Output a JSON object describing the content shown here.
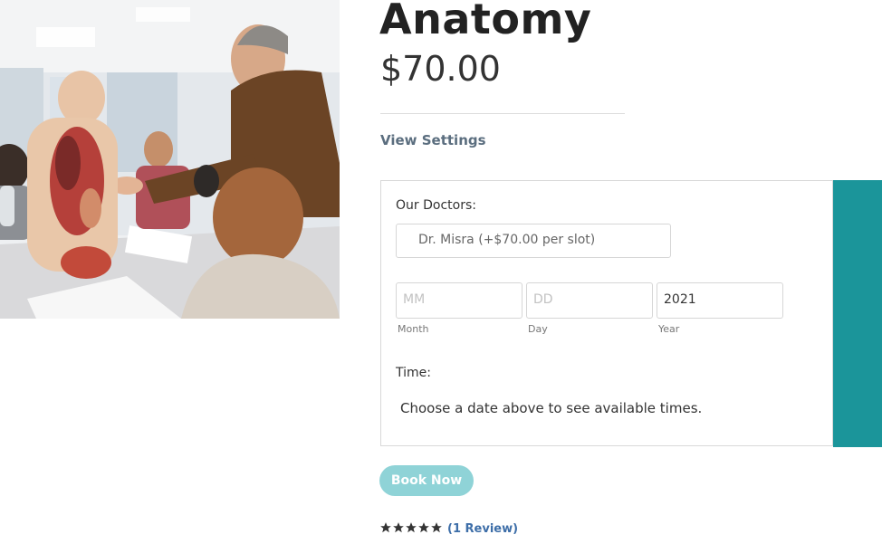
{
  "product": {
    "title": "Anatomy",
    "price": "$70.00",
    "view_settings": "View Settings"
  },
  "booking": {
    "doctors_label": "Our Doctors:",
    "doctor_selected": "Dr. Misra (+$70.00 per slot)",
    "month_placeholder": "MM",
    "day_placeholder": "DD",
    "year_value": "2021",
    "month_sub": "Month",
    "day_sub": "Day",
    "year_sub": "Year",
    "time_label": "Time:",
    "time_message": "Choose a date above to see available times."
  },
  "actions": {
    "book_now": "Book Now"
  },
  "rating": {
    "stars": 5,
    "review_text": "(1 Review)"
  },
  "colors": {
    "teal": "#1b959a",
    "button": "#8fd3d7",
    "link": "#3d6ea8"
  }
}
